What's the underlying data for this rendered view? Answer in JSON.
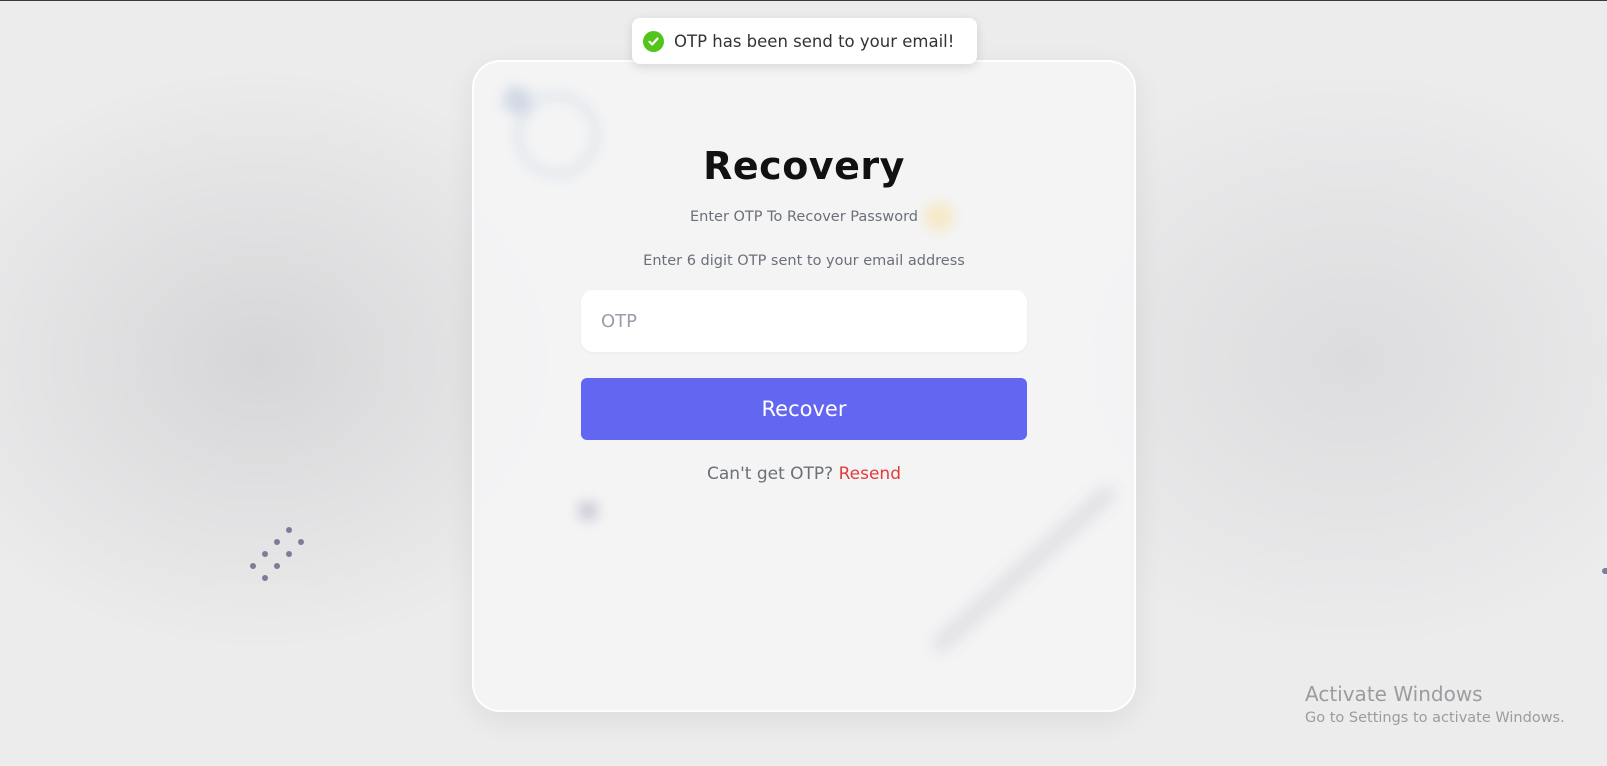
{
  "toast": {
    "message": "OTP has been send to your email!",
    "icon": "check-circle-icon",
    "color": "#52c41a"
  },
  "card": {
    "title": "Recovery",
    "subtitle": "Enter OTP To Recover Password",
    "hint": "Enter 6 digit OTP sent to your email address",
    "otp_input": {
      "value": "",
      "placeholder": "OTP"
    },
    "recover_button": "Recover",
    "resend_prompt": "Can't get OTP?",
    "resend_link": "Resend"
  },
  "colors": {
    "primary": "#6366f1",
    "link": "#e23b3b"
  },
  "watermark": {
    "title": "Activate Windows",
    "subtitle": "Go to Settings to activate Windows."
  }
}
